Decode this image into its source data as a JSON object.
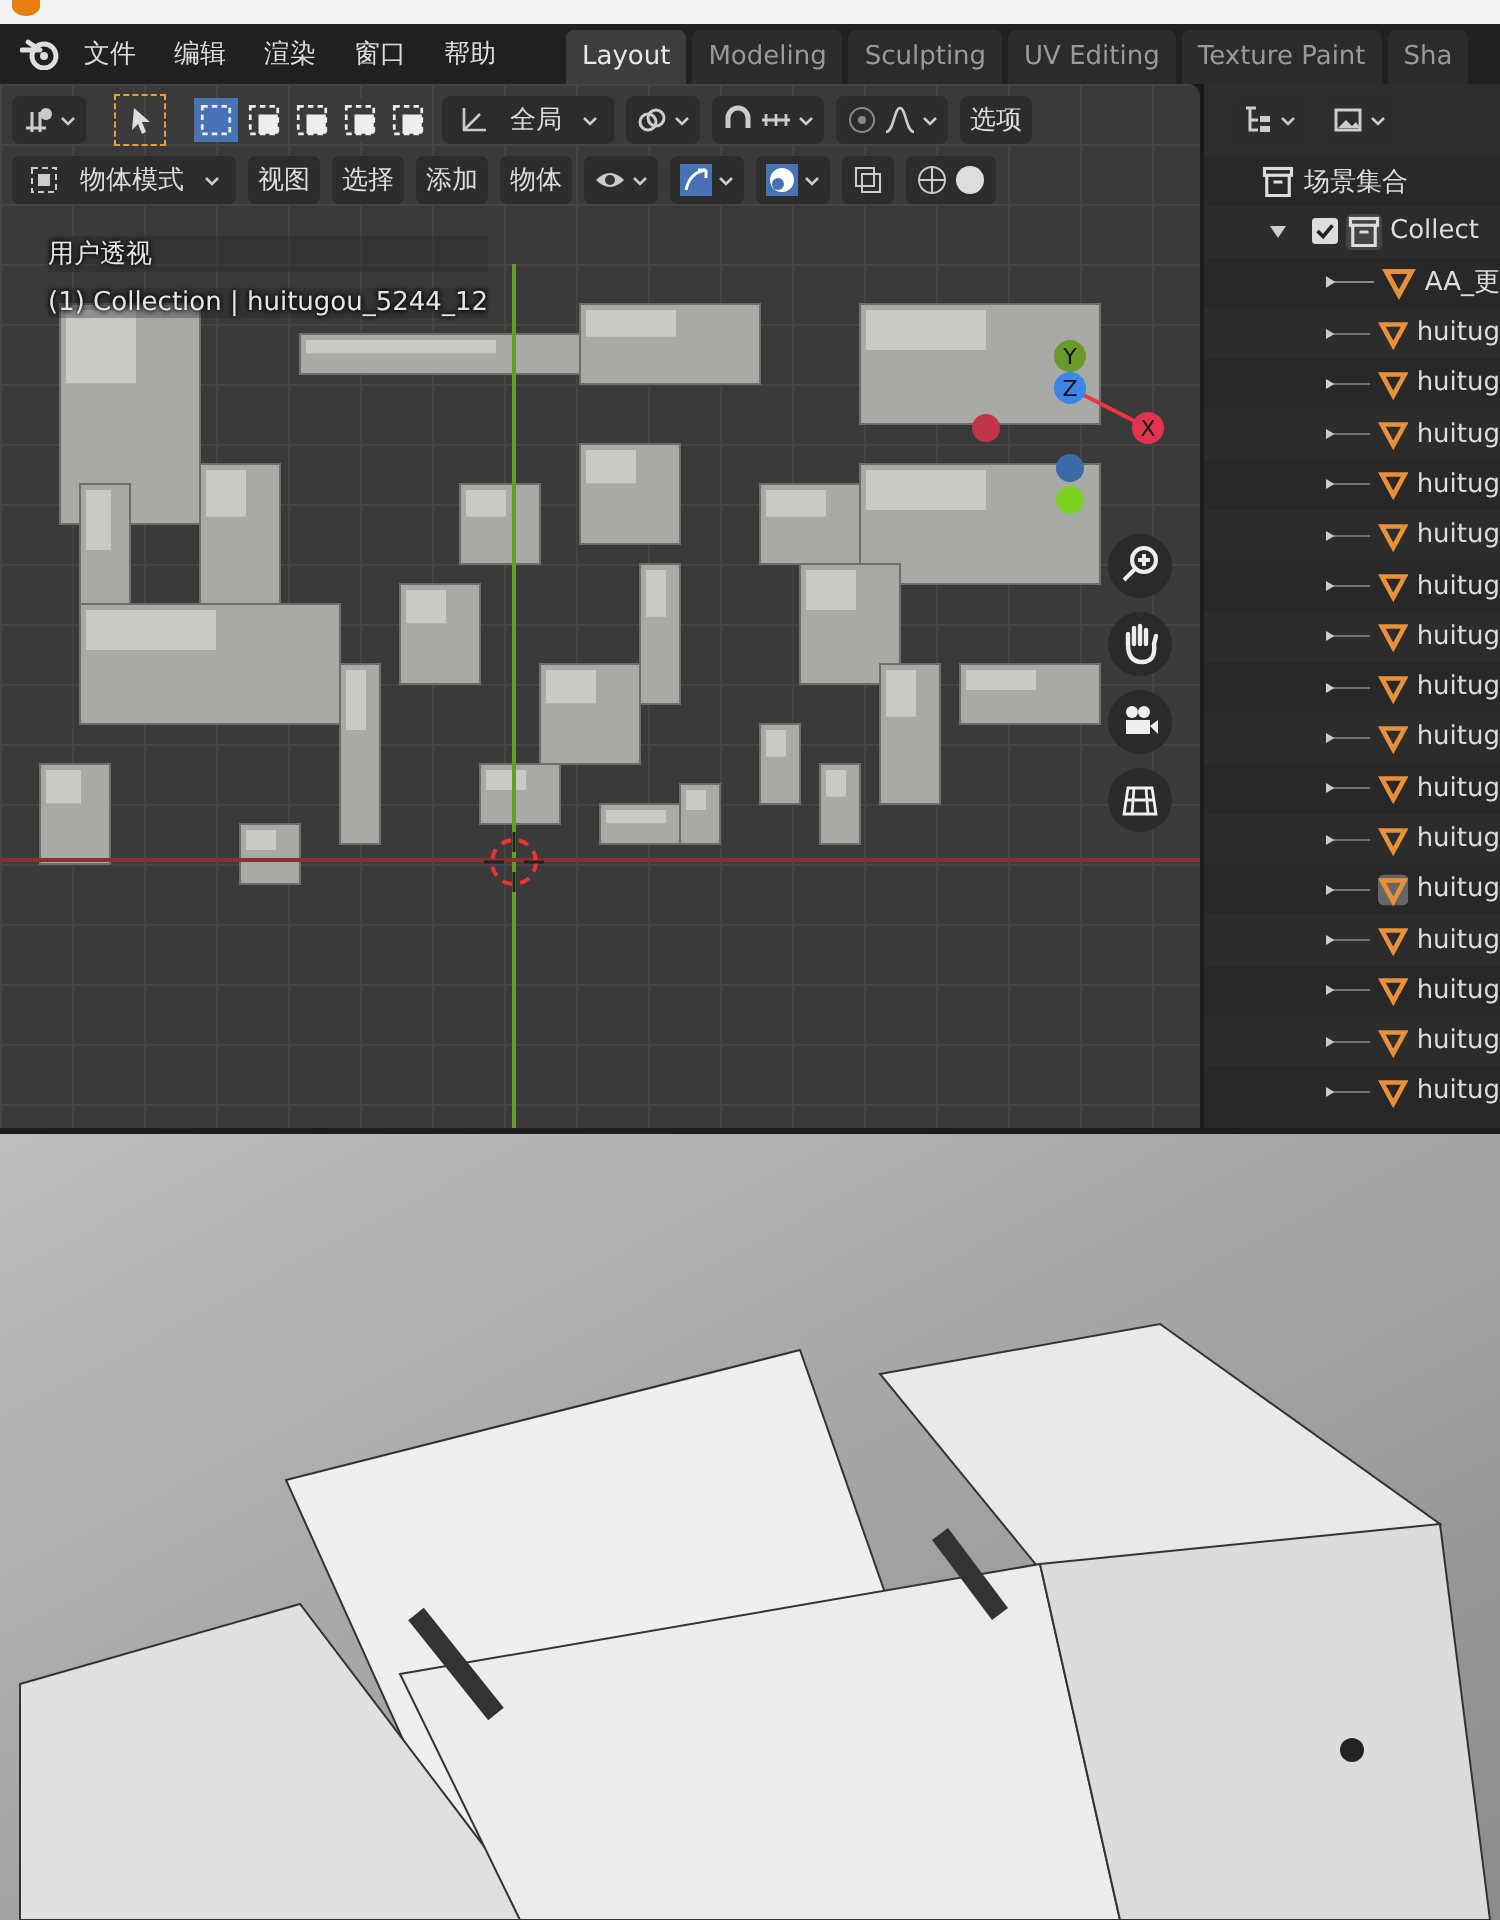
{
  "menu": [
    "文件",
    "编辑",
    "渲染",
    "窗口",
    "帮助"
  ],
  "tabs": [
    {
      "label": "Layout",
      "selected": true
    },
    {
      "label": "Modeling",
      "selected": false
    },
    {
      "label": "Sculpting",
      "selected": false
    },
    {
      "label": "UV Editing",
      "selected": false
    },
    {
      "label": "Texture Paint",
      "selected": false
    },
    {
      "label": "Sha",
      "selected": false
    }
  ],
  "toolbar": {
    "orientation": "全局",
    "options": "选项"
  },
  "header": {
    "mode": "物体模式",
    "menus": [
      "视图",
      "选择",
      "添加",
      "物体"
    ]
  },
  "viewport": {
    "view_name": "用户透视",
    "info": "(1) Collection | huitugou_5244_12",
    "axes": [
      "X",
      "Y",
      "Z"
    ]
  },
  "outliner": {
    "root": "场景集合",
    "collection": {
      "label": "Collect",
      "expanded": true,
      "checked": true,
      "children": [
        {
          "label": "AA_更",
          "selected": false
        },
        {
          "label": "huitug",
          "selected": false
        },
        {
          "label": "huitug",
          "selected": false
        },
        {
          "label": "huitug",
          "selected": false
        },
        {
          "label": "huitug",
          "selected": false
        },
        {
          "label": "huitug",
          "selected": false
        },
        {
          "label": "huitug",
          "selected": false
        },
        {
          "label": "huitug",
          "selected": false
        },
        {
          "label": "huitug",
          "selected": false
        },
        {
          "label": "huitug",
          "selected": false
        },
        {
          "label": "huitug",
          "selected": false
        },
        {
          "label": "huitug",
          "selected": false
        },
        {
          "label": "huitug",
          "selected": true
        },
        {
          "label": "huitug",
          "selected": false
        },
        {
          "label": "huitug",
          "selected": false
        },
        {
          "label": "huitug",
          "selected": false
        },
        {
          "label": "huitug",
          "selected": false
        }
      ]
    }
  }
}
